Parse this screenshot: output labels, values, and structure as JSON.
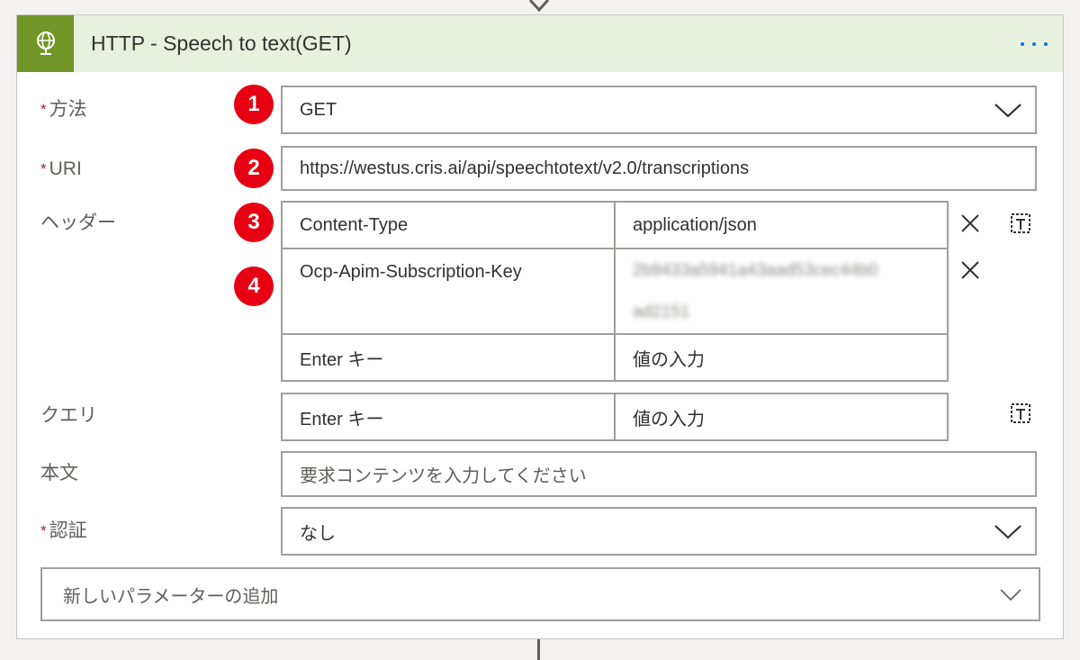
{
  "card": {
    "title": "HTTP - Speech to text(GET)",
    "icon": "globe-icon",
    "more_icon": "more-options-icon",
    "accent_color": "#709727",
    "header_bg": "#e8f0df"
  },
  "fields": {
    "method": {
      "label": "方法",
      "required_mark": "*",
      "value": "GET"
    },
    "uri": {
      "label": "URI",
      "required_mark": "*",
      "value": "https://westus.cris.ai/api/speechtotext/v2.0/transcriptions"
    },
    "headers": {
      "label": "ヘッダー",
      "rows": [
        {
          "key": "Content-Type",
          "value": "application/json"
        },
        {
          "key": "Ocp-Apim-Subscription-Key",
          "value_line1": "2b9433a5941a43aad53cec44b0",
          "value_line2": "ad2151"
        }
      ],
      "key_placeholder": "Enter キー",
      "value_placeholder": "値の入力"
    },
    "query": {
      "label": "クエリ",
      "key_placeholder": "Enter キー",
      "value_placeholder": "値の入力"
    },
    "body": {
      "label": "本文",
      "placeholder": "要求コンテンツを入力してください"
    },
    "auth": {
      "label": "認証",
      "required_mark": "*",
      "value": "なし"
    }
  },
  "add_parameter": {
    "placeholder": "新しいパラメーターの追加"
  },
  "badges": [
    "1",
    "2",
    "3",
    "4"
  ]
}
